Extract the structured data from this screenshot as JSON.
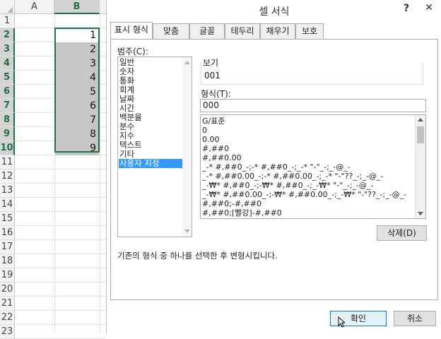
{
  "sheet": {
    "columns": [
      "A",
      "B"
    ],
    "selected_column": "B",
    "rows": [
      "1",
      "2",
      "3",
      "4",
      "5",
      "6",
      "7",
      "8",
      "9",
      "10",
      "11",
      "12",
      "13",
      "14",
      "15",
      "16",
      "17",
      "18",
      "19",
      "20",
      "21",
      "22",
      "23"
    ],
    "selected_rows": [
      "2",
      "3",
      "4",
      "5",
      "6",
      "7",
      "8",
      "9",
      "10"
    ],
    "b_values": [
      "1",
      "2",
      "3",
      "4",
      "5",
      "6",
      "7",
      "8",
      "9"
    ],
    "accent_color": "#217346",
    "highlight_color": "#c6c6c6"
  },
  "dialog": {
    "title": "셀 서식",
    "help_label": "?",
    "close_label": "✕",
    "tabs": [
      "표시 형식",
      "맞춤",
      "글꼴",
      "테두리",
      "채우기",
      "보호"
    ],
    "active_tab": "표시 형식",
    "category_label": "범주(C):",
    "categories": [
      "일반",
      "숫자",
      "통화",
      "회계",
      "날짜",
      "시간",
      "백분율",
      "분수",
      "지수",
      "텍스트",
      "기타",
      "사용자 지정"
    ],
    "selected_category": "사용자 지정",
    "sample_label": "보기",
    "sample_value": "001",
    "type_label": "형식(T):",
    "type_value": "000",
    "formats": [
      "G/표준",
      "0",
      "0.00",
      "#,##0",
      "#,##0.00",
      "_-* #,##0_-;-* #,##0_-;_-* \"-\"_-;_-@_-",
      "_-* #,##0.00_-;-* #,##0.00_-;_-* \"-\"??_-;_-@_-",
      "_-₩* #,##0_-;-₩* #,##0_-;_-₩* \"-\"_-;_-@_-",
      "_-₩* #,##0.00_-;-₩* #,##0.00_-;_-₩* \"-\"??_-;_-@_-",
      "#,##0;-#,##0",
      "#,##0;[빨강]-#,##0"
    ],
    "delete_label": "삭제(D)",
    "description": "기존의 형식 중 하나를 선택한 후 변형시킵니다.",
    "ok_label": "확인",
    "cancel_label": "취소",
    "selection_color": "#3399ff"
  }
}
